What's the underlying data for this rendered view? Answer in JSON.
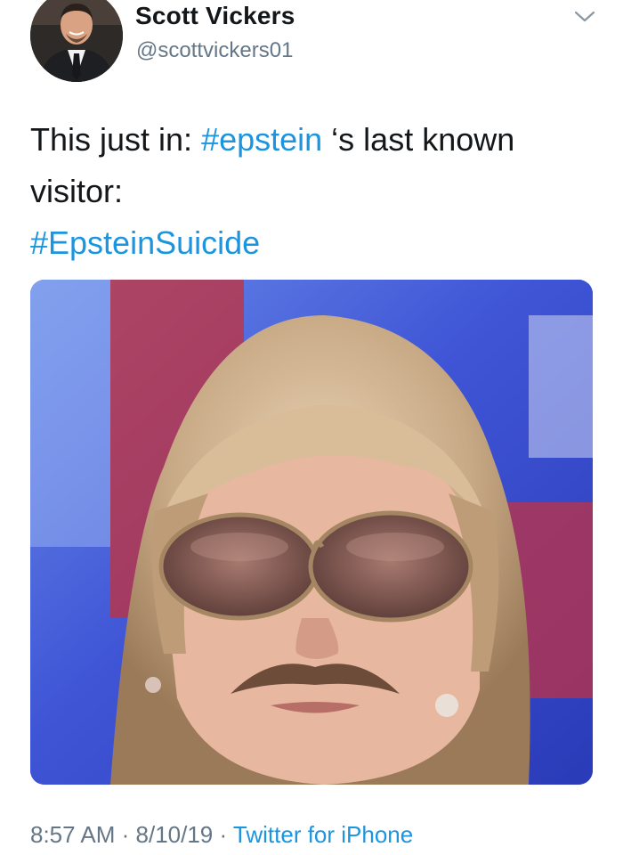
{
  "tweet": {
    "display_name": "Scott Vickers",
    "handle": "@scottvickers01",
    "text_intro": "This just in: ",
    "hashtag_1": "#epstein",
    "text_after": " ‘s last known visitor:",
    "hashtag_2": "#EpsteinSuicide",
    "time": "8:57 AM",
    "separator": " · ",
    "date": "8/10/19",
    "source": "Twitter for iPhone"
  },
  "icons": {
    "menu": "chevron-down-icon"
  },
  "colors": {
    "link": "#1b95e0",
    "secondary_text": "#657786",
    "primary_text": "#14171a"
  }
}
